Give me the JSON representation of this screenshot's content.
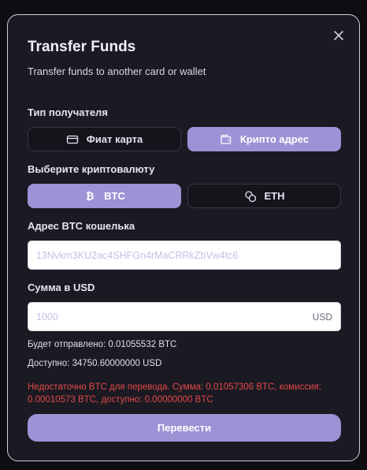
{
  "modal": {
    "title": "Transfer Funds",
    "subtitle": "Transfer funds to another card or wallet"
  },
  "recipient": {
    "label": "Тип получателя",
    "options": [
      {
        "label": "Фиат карта",
        "icon": "card-icon",
        "active": false
      },
      {
        "label": "Крипто адрес",
        "icon": "wallet-icon",
        "active": true
      }
    ]
  },
  "crypto": {
    "label": "Выберите криптовалюту",
    "options": [
      {
        "label": "BTC",
        "icon": "bitcoin-icon",
        "active": true
      },
      {
        "label": "ETH",
        "icon": "coins-icon",
        "active": false
      }
    ]
  },
  "address": {
    "label": "Адрес BTC кошелька",
    "placeholder": "13Nvkm3KU2ac4SHFGn4rMaCRRkZbVw4tc6"
  },
  "amount": {
    "label": "Сумма в USD",
    "placeholder": "1000",
    "currency": "USD"
  },
  "summary": {
    "will_send": "Будет отправлено: 0.01055532 BTC",
    "available": "Доступно: 34750.60000000 USD"
  },
  "error": "Недостаточно BTC для перевода. Сумма: 0.01057306 BTC, комиссия: 0.00010573 BTC, доступно: 0.00000000 BTC",
  "submit_label": "Перевести",
  "colors": {
    "accent": "#9b93d6",
    "background": "#1b1a22",
    "error": "#e3484a"
  }
}
